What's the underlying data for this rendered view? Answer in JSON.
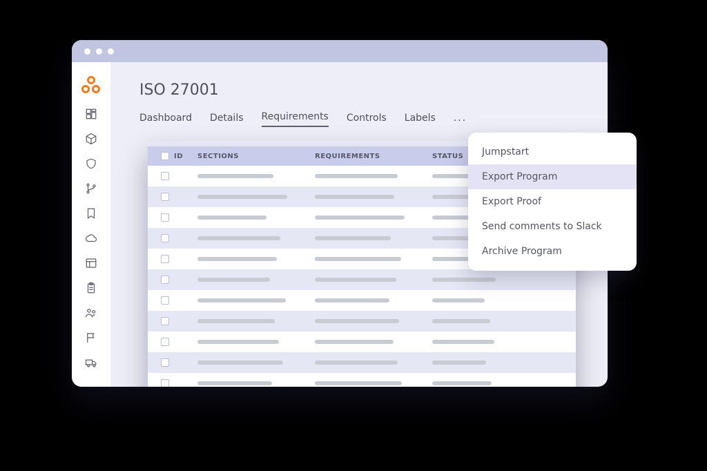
{
  "page_title": "ISO 27001",
  "tabs": {
    "dashboard": "Dashboard",
    "details": "Details",
    "requirements": "Requirements",
    "controls": "Controls",
    "labels": "Labels",
    "more": "..."
  },
  "active_tab": "requirements",
  "table": {
    "columns": {
      "id": "ID",
      "sections": "SECTIONS",
      "requirements": "REQUIREMENTS",
      "status": "STATUS"
    }
  },
  "menu": {
    "jumpstart": "Jumpstart",
    "export_program": "Export Program",
    "export_proof": "Export Proof",
    "send_comments": "Send comments to Slack",
    "archive": "Archive Program"
  },
  "menu_hover": "export_program",
  "sidebar_icons": [
    "dashboard",
    "package",
    "shield",
    "branch",
    "bookmark",
    "cloud",
    "layout",
    "clipboard",
    "team",
    "flag",
    "truck"
  ]
}
